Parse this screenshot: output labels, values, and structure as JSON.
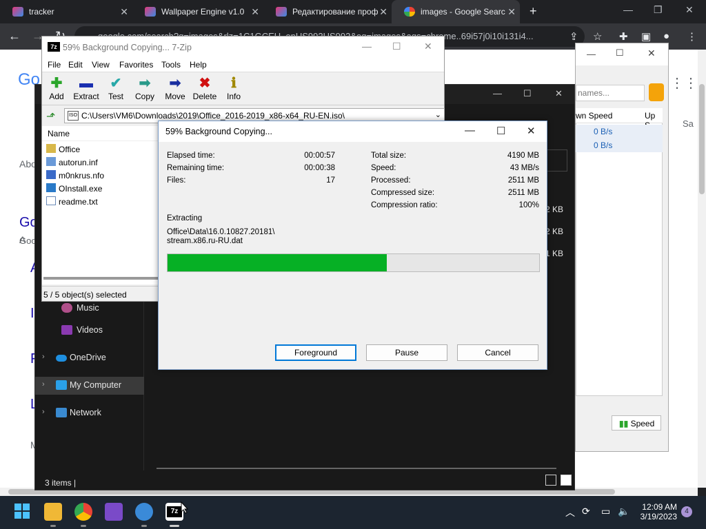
{
  "browser": {
    "tabs": [
      {
        "title": "tracker"
      },
      {
        "title": "Wallpaper Engine v1.0"
      },
      {
        "title": "Редактирование проф"
      },
      {
        "title": "images - Google Searc"
      }
    ],
    "new_tab": "+",
    "url": "google.com/search?q=images&rlz=1C1GCEU_enUS992US992&oq=images&aqs=chrome..69i57j0i10i131i4..."
  },
  "google": {
    "side_fragments": [
      "Abo",
      "Go",
      "Goo",
      "A",
      "I",
      "F",
      "L",
      "M",
      "Sa"
    ]
  },
  "qbittorrent": {
    "search_placeholder": "names...",
    "col_down": "wn Speed",
    "col_up": "Up S",
    "rows": [
      {
        "down": "0 B/s"
      },
      {
        "down": "0 B/s"
      }
    ],
    "speed_button": "Speed"
  },
  "file_manager": {
    "sidebar": [
      {
        "label": "Music",
        "expandable": false
      },
      {
        "label": "Videos",
        "expandable": false
      },
      {
        "label": "OneDrive",
        "expandable": true
      },
      {
        "label": "My Computer",
        "expandable": true,
        "selected": true
      },
      {
        "label": "Network",
        "expandable": true
      }
    ],
    "sizes": [
      "2 KB",
      "2 KB",
      "1 KB"
    ],
    "status": "3 items  |"
  },
  "sevenzip": {
    "title": "59% Background Copying... 7-Zip",
    "logo": "7z",
    "menu": [
      "File",
      "Edit",
      "View",
      "Favorites",
      "Tools",
      "Help"
    ],
    "toolbar": [
      {
        "label": "Add",
        "glyph": "✚",
        "color": "#2aa52a"
      },
      {
        "label": "Extract",
        "glyph": "▬",
        "color": "#1a2fb0"
      },
      {
        "label": "Test",
        "glyph": "✔",
        "color": "#28a8a8"
      },
      {
        "label": "Copy",
        "glyph": "➡",
        "color": "#2a9a8a"
      },
      {
        "label": "Move",
        "glyph": "➡",
        "color": "#1a2fa0"
      },
      {
        "label": "Delete",
        "glyph": "✖",
        "color": "#d01010"
      },
      {
        "label": "Info",
        "glyph": "ℹ",
        "color": "#a08800"
      }
    ],
    "path": "C:\\Users\\VM6\\Downloads\\2019\\Office_2016-2019_x86-x64_RU-EN.iso\\",
    "path_icon": "ISO",
    "column_name": "Name",
    "files": [
      {
        "name": "Office",
        "icon": "folder-icon"
      },
      {
        "name": "autorun.inf",
        "icon": "file-inf-icon"
      },
      {
        "name": "m0nkrus.nfo",
        "icon": "file-nfo-icon"
      },
      {
        "name": "OInstall.exe",
        "icon": "file-exe-icon"
      },
      {
        "name": "readme.txt",
        "icon": "file-txt-icon"
      }
    ],
    "status": "5 / 5 object(s) selected"
  },
  "copy_dialog": {
    "title": "59% Background Copying...",
    "left": [
      {
        "label": "Elapsed time:",
        "value": "00:00:57"
      },
      {
        "label": "Remaining time:",
        "value": "00:00:38"
      },
      {
        "label": "Files:",
        "value": "17"
      }
    ],
    "right": [
      {
        "label": "Total size:",
        "value": "4190 MB"
      },
      {
        "label": "Speed:",
        "value": "43 MB/s"
      },
      {
        "label": "Processed:",
        "value": "2511 MB"
      },
      {
        "label": "Compressed size:",
        "value": "2511 MB"
      },
      {
        "label": "Compression ratio:",
        "value": "100%"
      }
    ],
    "action": "Extracting",
    "file_line1": "Office\\Data\\16.0.10827.20181\\",
    "file_line2": "stream.x86.ru-RU.dat",
    "progress": 0.59,
    "progress_color": "#06b025",
    "buttons": {
      "foreground": "Foreground",
      "pause": "Pause",
      "cancel": "Cancel"
    }
  },
  "taskbar": {
    "time": "12:09 AM",
    "date": "3/19/2023",
    "notifications": "4"
  }
}
